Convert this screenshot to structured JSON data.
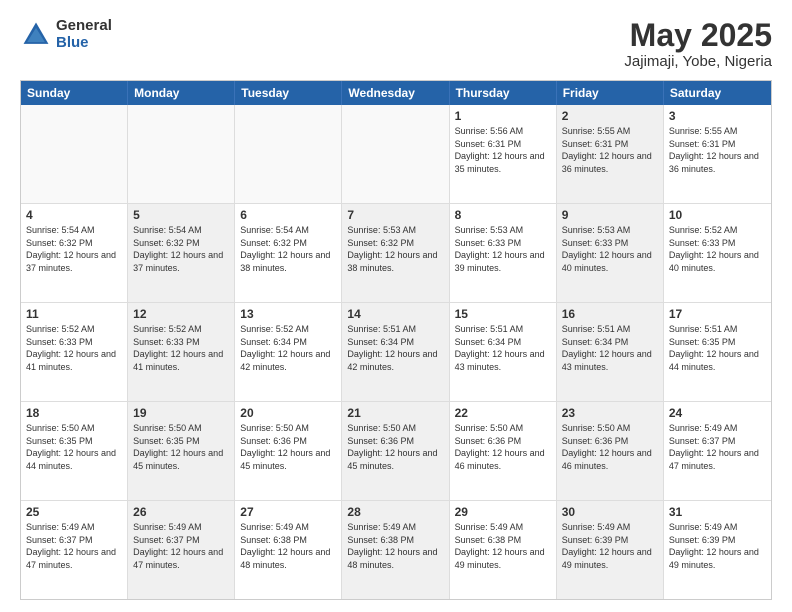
{
  "logo": {
    "general": "General",
    "blue": "Blue"
  },
  "title": {
    "month": "May 2025",
    "location": "Jajimaji, Yobe, Nigeria"
  },
  "weekdays": [
    "Sunday",
    "Monday",
    "Tuesday",
    "Wednesday",
    "Thursday",
    "Friday",
    "Saturday"
  ],
  "rows": [
    [
      {
        "day": "",
        "info": "",
        "empty": true
      },
      {
        "day": "",
        "info": "",
        "empty": true
      },
      {
        "day": "",
        "info": "",
        "empty": true
      },
      {
        "day": "",
        "info": "",
        "empty": true
      },
      {
        "day": "1",
        "info": "Sunrise: 5:56 AM\nSunset: 6:31 PM\nDaylight: 12 hours and 35 minutes."
      },
      {
        "day": "2",
        "info": "Sunrise: 5:55 AM\nSunset: 6:31 PM\nDaylight: 12 hours and 36 minutes.",
        "shaded": true
      },
      {
        "day": "3",
        "info": "Sunrise: 5:55 AM\nSunset: 6:31 PM\nDaylight: 12 hours and 36 minutes."
      }
    ],
    [
      {
        "day": "4",
        "info": "Sunrise: 5:54 AM\nSunset: 6:32 PM\nDaylight: 12 hours and 37 minutes."
      },
      {
        "day": "5",
        "info": "Sunrise: 5:54 AM\nSunset: 6:32 PM\nDaylight: 12 hours and 37 minutes.",
        "shaded": true
      },
      {
        "day": "6",
        "info": "Sunrise: 5:54 AM\nSunset: 6:32 PM\nDaylight: 12 hours and 38 minutes."
      },
      {
        "day": "7",
        "info": "Sunrise: 5:53 AM\nSunset: 6:32 PM\nDaylight: 12 hours and 38 minutes.",
        "shaded": true
      },
      {
        "day": "8",
        "info": "Sunrise: 5:53 AM\nSunset: 6:33 PM\nDaylight: 12 hours and 39 minutes."
      },
      {
        "day": "9",
        "info": "Sunrise: 5:53 AM\nSunset: 6:33 PM\nDaylight: 12 hours and 40 minutes.",
        "shaded": true
      },
      {
        "day": "10",
        "info": "Sunrise: 5:52 AM\nSunset: 6:33 PM\nDaylight: 12 hours and 40 minutes."
      }
    ],
    [
      {
        "day": "11",
        "info": "Sunrise: 5:52 AM\nSunset: 6:33 PM\nDaylight: 12 hours and 41 minutes."
      },
      {
        "day": "12",
        "info": "Sunrise: 5:52 AM\nSunset: 6:33 PM\nDaylight: 12 hours and 41 minutes.",
        "shaded": true
      },
      {
        "day": "13",
        "info": "Sunrise: 5:52 AM\nSunset: 6:34 PM\nDaylight: 12 hours and 42 minutes."
      },
      {
        "day": "14",
        "info": "Sunrise: 5:51 AM\nSunset: 6:34 PM\nDaylight: 12 hours and 42 minutes.",
        "shaded": true
      },
      {
        "day": "15",
        "info": "Sunrise: 5:51 AM\nSunset: 6:34 PM\nDaylight: 12 hours and 43 minutes."
      },
      {
        "day": "16",
        "info": "Sunrise: 5:51 AM\nSunset: 6:34 PM\nDaylight: 12 hours and 43 minutes.",
        "shaded": true
      },
      {
        "day": "17",
        "info": "Sunrise: 5:51 AM\nSunset: 6:35 PM\nDaylight: 12 hours and 44 minutes."
      }
    ],
    [
      {
        "day": "18",
        "info": "Sunrise: 5:50 AM\nSunset: 6:35 PM\nDaylight: 12 hours and 44 minutes."
      },
      {
        "day": "19",
        "info": "Sunrise: 5:50 AM\nSunset: 6:35 PM\nDaylight: 12 hours and 45 minutes.",
        "shaded": true
      },
      {
        "day": "20",
        "info": "Sunrise: 5:50 AM\nSunset: 6:36 PM\nDaylight: 12 hours and 45 minutes."
      },
      {
        "day": "21",
        "info": "Sunrise: 5:50 AM\nSunset: 6:36 PM\nDaylight: 12 hours and 45 minutes.",
        "shaded": true
      },
      {
        "day": "22",
        "info": "Sunrise: 5:50 AM\nSunset: 6:36 PM\nDaylight: 12 hours and 46 minutes."
      },
      {
        "day": "23",
        "info": "Sunrise: 5:50 AM\nSunset: 6:36 PM\nDaylight: 12 hours and 46 minutes.",
        "shaded": true
      },
      {
        "day": "24",
        "info": "Sunrise: 5:49 AM\nSunset: 6:37 PM\nDaylight: 12 hours and 47 minutes."
      }
    ],
    [
      {
        "day": "25",
        "info": "Sunrise: 5:49 AM\nSunset: 6:37 PM\nDaylight: 12 hours and 47 minutes."
      },
      {
        "day": "26",
        "info": "Sunrise: 5:49 AM\nSunset: 6:37 PM\nDaylight: 12 hours and 47 minutes.",
        "shaded": true
      },
      {
        "day": "27",
        "info": "Sunrise: 5:49 AM\nSunset: 6:38 PM\nDaylight: 12 hours and 48 minutes."
      },
      {
        "day": "28",
        "info": "Sunrise: 5:49 AM\nSunset: 6:38 PM\nDaylight: 12 hours and 48 minutes.",
        "shaded": true
      },
      {
        "day": "29",
        "info": "Sunrise: 5:49 AM\nSunset: 6:38 PM\nDaylight: 12 hours and 49 minutes."
      },
      {
        "day": "30",
        "info": "Sunrise: 5:49 AM\nSunset: 6:39 PM\nDaylight: 12 hours and 49 minutes.",
        "shaded": true
      },
      {
        "day": "31",
        "info": "Sunrise: 5:49 AM\nSunset: 6:39 PM\nDaylight: 12 hours and 49 minutes."
      }
    ]
  ]
}
